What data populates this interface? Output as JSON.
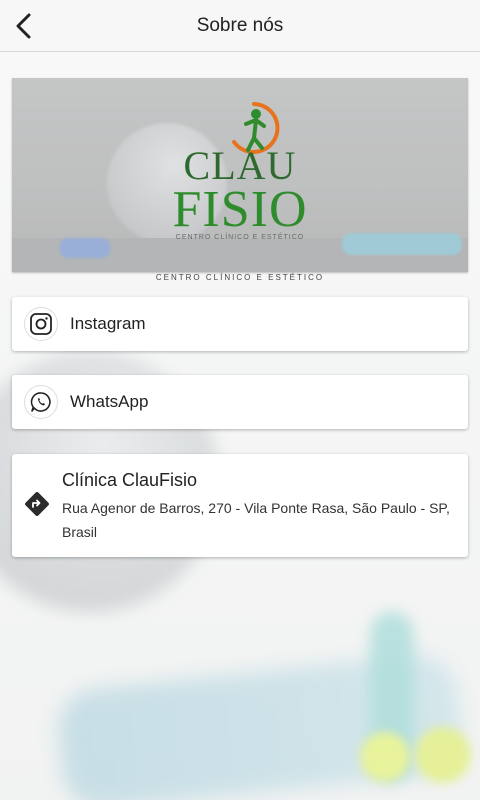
{
  "header": {
    "title": "Sobre nós"
  },
  "banner": {
    "logo_top": "CLAU",
    "logo_bottom": "FISIO",
    "logo_tagline": "CENTRO CLÍNICO E ESTÉTICO",
    "subtitle": "CENTRO CLÍNICO E ESTÉTICO"
  },
  "links": {
    "instagram": {
      "label": "Instagram",
      "icon": "instagram-icon"
    },
    "whatsapp": {
      "label": "WhatsApp",
      "icon": "whatsapp-icon"
    }
  },
  "location": {
    "name": "Clínica ClauFisio",
    "address": "Rua Agenor de Barros, 270 - Vila Ponte Rasa, São Paulo - SP, Brasil",
    "icon": "directions-icon"
  },
  "colors": {
    "logo_green": "#2f8c2d",
    "logo_orange": "#e8731f",
    "directions": "#2b2b2b"
  }
}
